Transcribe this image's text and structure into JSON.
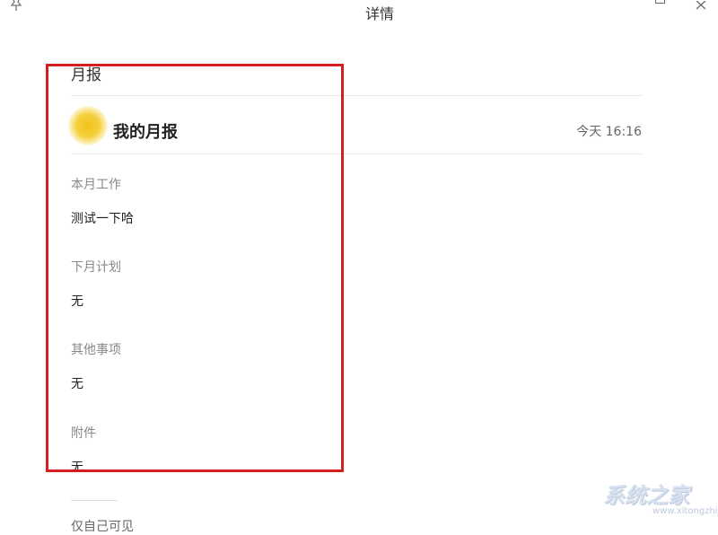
{
  "window": {
    "title": "详情",
    "pin_icon": "pin-icon",
    "maximize_icon": "maximize-icon",
    "close_icon": "close-icon"
  },
  "report": {
    "title": "月报",
    "author_name": "我的月报",
    "timestamp": "今天 16:16",
    "sections": [
      {
        "label": "本月工作",
        "value": "测试一下哈"
      },
      {
        "label": "下月计划",
        "value": "无"
      },
      {
        "label": "其他事项",
        "value": "无"
      },
      {
        "label": "附件",
        "value": "无"
      }
    ],
    "visibility": "仅自己可见"
  },
  "watermark": {
    "text": "系统之家",
    "url": "www.xitongzhijia.net"
  },
  "colors": {
    "highlight": "#d41f1f",
    "avatar": "#f2c21a"
  }
}
